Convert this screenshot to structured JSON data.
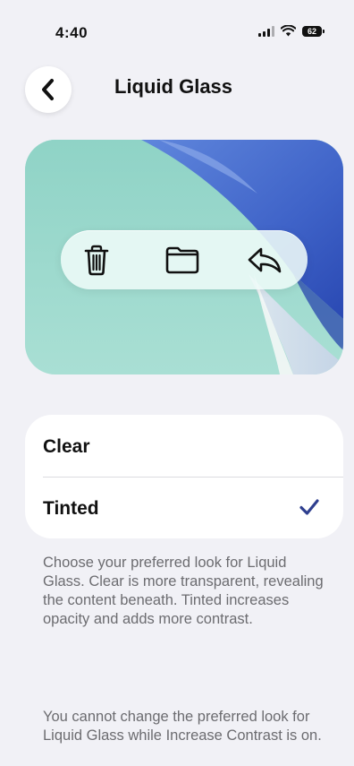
{
  "status_bar": {
    "time": "4:40",
    "battery_level": "62"
  },
  "nav": {
    "title": "Liquid Glass",
    "back_icon": "chevron-left-icon"
  },
  "preview": {
    "toolbar_icons": [
      "trash-icon",
      "folder-icon",
      "reply-icon"
    ]
  },
  "options": [
    {
      "label": "Clear",
      "selected": false
    },
    {
      "label": "Tinted",
      "selected": true
    }
  ],
  "footnotes": [
    "Choose your preferred look for Liquid Glass. Clear is more transparent, revealing the content beneath. Tinted increases opacity and adds more contrast.",
    "You cannot change the preferred look for Liquid Glass while Increase Contrast is on."
  ],
  "colors": {
    "accent": "#2f3f8f",
    "background": "#f1f1f6",
    "card": "#ffffff",
    "footnote_text": "#6c6c70"
  }
}
